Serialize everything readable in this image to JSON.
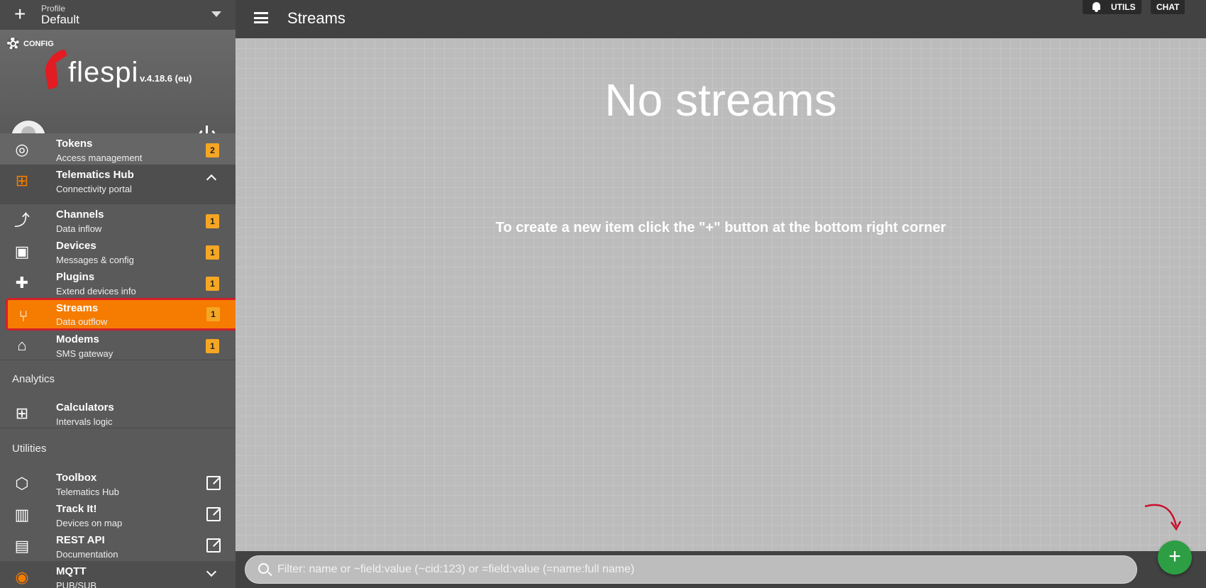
{
  "profile": {
    "label": "Profile",
    "value": "Default"
  },
  "brand": {
    "config_label": "CONFIG",
    "logo_text": "flespi",
    "version": "v.4.18.6 (eu)"
  },
  "nav": {
    "tokens": {
      "title": "Tokens",
      "subtitle": "Access management",
      "badge": "2"
    },
    "hub": {
      "title": "Telematics Hub",
      "subtitle": "Connectivity portal"
    },
    "channels": {
      "title": "Channels",
      "subtitle": "Data inflow",
      "badge": "1"
    },
    "devices": {
      "title": "Devices",
      "subtitle": "Messages & config",
      "badge": "1"
    },
    "plugins": {
      "title": "Plugins",
      "subtitle": "Extend devices info",
      "badge": "1"
    },
    "streams": {
      "title": "Streams",
      "subtitle": "Data outflow",
      "badge": "1"
    },
    "modems": {
      "title": "Modems",
      "subtitle": "SMS gateway",
      "badge": "1"
    },
    "analytics_section": "Analytics",
    "calculators": {
      "title": "Calculators",
      "subtitle": "Intervals logic"
    },
    "utilities_section": "Utilities",
    "toolbox": {
      "title": "Toolbox",
      "subtitle": "Telematics Hub"
    },
    "trackit": {
      "title": "Track It!",
      "subtitle": "Devices on map"
    },
    "restapi": {
      "title": "REST API",
      "subtitle": "Documentation"
    },
    "mqtt": {
      "title": "MQTT",
      "subtitle": "PUB/SUB"
    }
  },
  "header": {
    "title": "Streams",
    "utils_label": "UTILS",
    "chat_label": "CHAT"
  },
  "main": {
    "empty_title": "No streams",
    "empty_hint": "To create a new item click the \"+\" button at the bottom right corner"
  },
  "search": {
    "placeholder": "Filter: name or ~field:value (~cid:123) or =field:value (=name:full name)"
  },
  "fab": {
    "label": "+"
  },
  "colors": {
    "accent": "#f57c00",
    "fab": "#2e9e44",
    "badge": "#f5a623",
    "highlight": "#d0202a"
  }
}
